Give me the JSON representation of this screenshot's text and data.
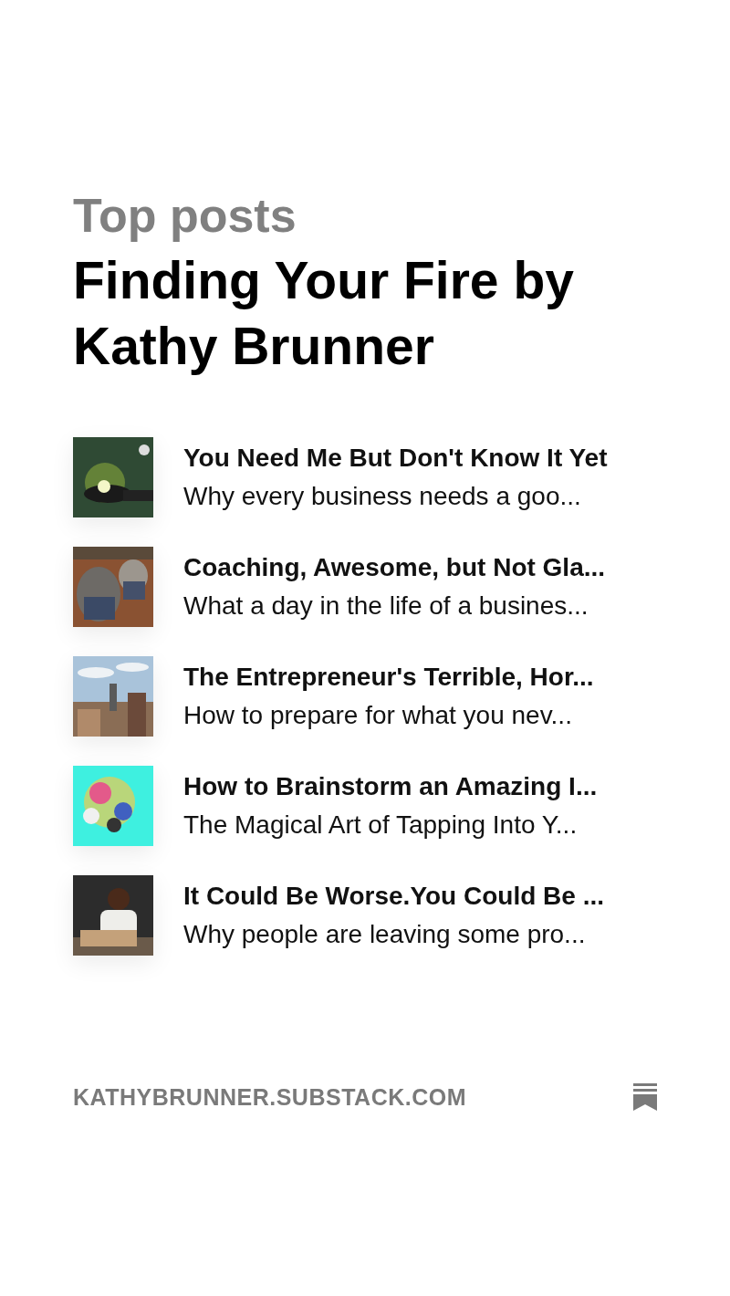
{
  "heading": "Top posts",
  "publication": "Finding Your Fire by Kathy Brunner",
  "posts": [
    {
      "title": "You Need Me But Don't Know It Yet",
      "subtitle": "Why every business needs a goo..."
    },
    {
      "title": "Coaching, Awesome, but Not Gla...",
      "subtitle": "What a day in the life of a busines..."
    },
    {
      "title": "The Entrepreneur's Terrible, Hor...",
      "subtitle": "How to prepare for what you nev..."
    },
    {
      "title": "How to Brainstorm an Amazing I...",
      "subtitle": "The Magical Art of Tapping Into Y..."
    },
    {
      "title": "It Could Be Worse.You Could Be ...",
      "subtitle": "Why people are leaving some pro..."
    }
  ],
  "footer": {
    "domain": "KATHYBRUNNER.SUBSTACK.COM"
  }
}
